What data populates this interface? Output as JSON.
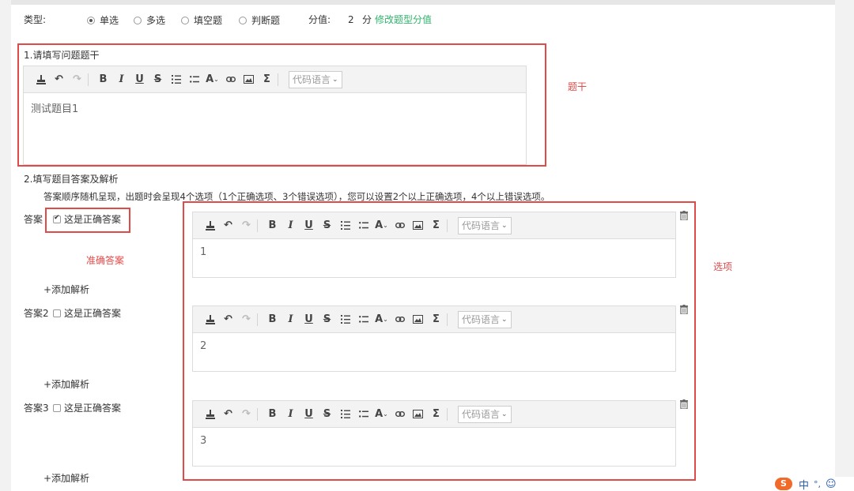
{
  "type_row": {
    "label": "类型:",
    "options": [
      "单选",
      "多选",
      "填空题",
      "判断题"
    ],
    "selected": "单选",
    "score_label": "分值:",
    "score_value": "2",
    "score_unit": "分",
    "edit_link": "修改题型分值"
  },
  "section1": {
    "title": "1.请填写问题题干",
    "content": "测试题目1"
  },
  "section2": {
    "title": "2.填写题目答案及解析",
    "hint": "答案顺序随机呈现，出题时会呈现4个选项（1个正确选项、3个错误选项），您可以设置2个以上正确选项，4个以上错误选项。"
  },
  "answers": [
    {
      "label": "答案",
      "checkbox_label": "这是正确答案",
      "checked": true,
      "content": "1",
      "add_analysis": "+添加解析"
    },
    {
      "label": "答案2",
      "checkbox_label": "这是正确答案",
      "checked": false,
      "content": "2",
      "add_analysis": "+添加解析"
    },
    {
      "label": "答案3",
      "checkbox_label": "这是正确答案",
      "checked": false,
      "content": "3",
      "add_analysis": "+添加解析"
    }
  ],
  "editor": {
    "code_language_placeholder": "代码语言"
  },
  "annotations": {
    "stem": "题干",
    "correct": "准确答案",
    "options": "选项"
  },
  "ime": {
    "mode": "中"
  },
  "colors": {
    "annotation_red": "#e24a4a",
    "link_green": "#2fb36b",
    "toolbar_bg": "#f3f3f3"
  },
  "icons": [
    "format-brush-icon",
    "undo-icon",
    "redo-icon",
    "bold-icon",
    "italic-icon",
    "underline-icon",
    "strikethrough-icon",
    "ordered-list-icon",
    "unordered-list-icon",
    "font-color-icon",
    "link-icon",
    "image-icon",
    "formula-icon",
    "trash-icon"
  ]
}
